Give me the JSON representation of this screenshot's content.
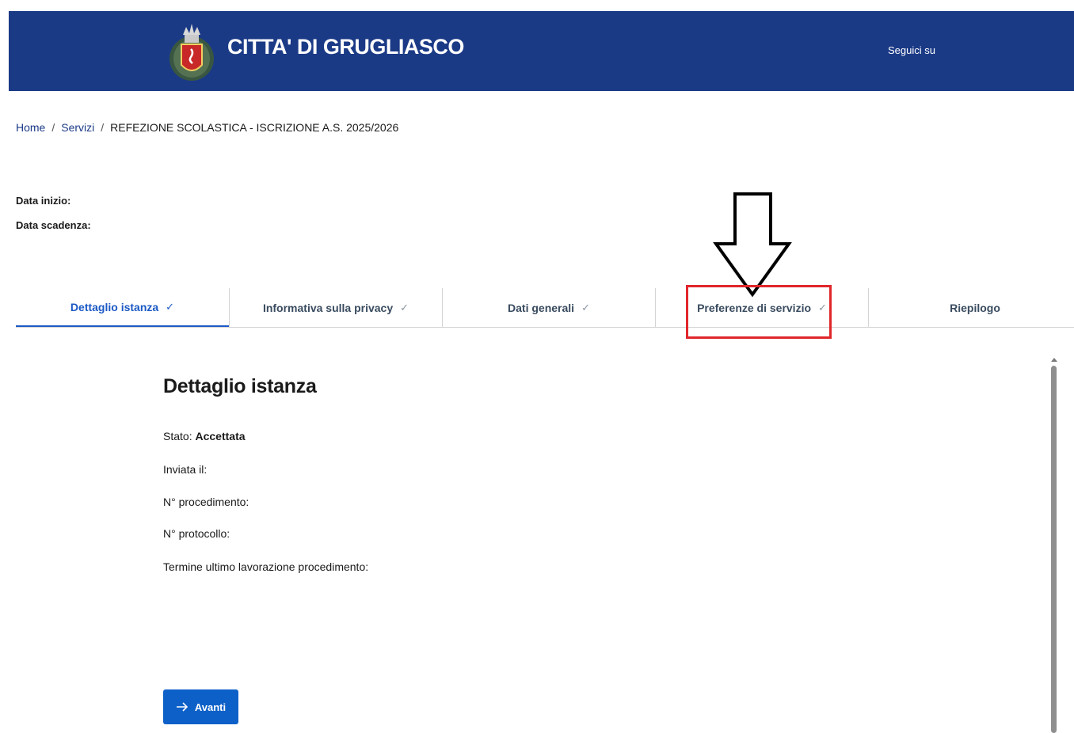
{
  "header": {
    "site_title": "CITTA' DI GRUGLIASCO",
    "follow_label": "Seguici su",
    "bg_color": "#1b3a86"
  },
  "breadcrumb": {
    "home": "Home",
    "services": "Servizi",
    "current": "REFEZIONE SCOLASTICA - ISCRIZIONE A.S. 2025/2026"
  },
  "meta": {
    "start_label": "Data inizio:",
    "end_label": "Data scadenza:"
  },
  "tabs": [
    {
      "label": "Dettaglio istanza",
      "active": true,
      "check": true
    },
    {
      "label": "Informativa sulla privacy",
      "active": false,
      "check": true
    },
    {
      "label": "Dati generali",
      "active": false,
      "check": true
    },
    {
      "label": "Preferenze di servizio",
      "active": false,
      "check": true
    },
    {
      "label": "Riepilogo",
      "active": false,
      "check": false
    }
  ],
  "detail": {
    "title": "Dettaglio istanza",
    "status_label": "Stato:",
    "status_value": "Accettata",
    "sent_label": "Inviata il:",
    "procedure_label": "N° procedimento:",
    "protocol_label": "N° protocollo:",
    "deadline_label": "Termine ultimo lavorazione procedimento:"
  },
  "actions": {
    "next_label": "Avanti"
  },
  "icons": {
    "check": "check-icon",
    "arrow_right": "arrow-right-icon",
    "crest": "coat-of-arms-icon",
    "annotation_arrow": "down-arrow-icon"
  },
  "colors": {
    "accent": "#1b59c5",
    "button": "#0d60c8",
    "highlight": "#e0262b"
  }
}
